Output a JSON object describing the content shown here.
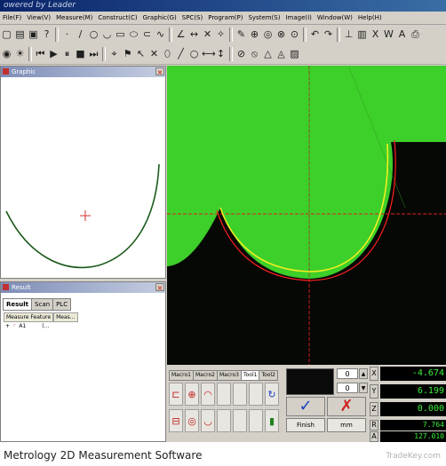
{
  "window": {
    "title": "owered by Leader"
  },
  "menubar": [
    "File(F)",
    "View(V)",
    "Measure(M)",
    "Construct(C)",
    "Graphic(G)",
    "SPC(S)",
    "Program(P)",
    "System(S)",
    "Image(I)",
    "Window(W)",
    "Help(H)"
  ],
  "graphic_panel": {
    "title": "Graphic",
    "close": "×"
  },
  "result_panel": {
    "title": "Result",
    "close": "×",
    "tabs": [
      "Result",
      "Scan",
      "PLC"
    ],
    "columns": [
      "Measure Feature",
      "Meas..."
    ],
    "rows": [
      {
        "icon": "arc-icon",
        "name": "A1",
        "value": "(..."
      }
    ]
  },
  "macro_tabs": [
    "Macro1",
    "Macro2",
    "Macro3",
    "Tool1",
    "Tool2"
  ],
  "controls": {
    "spin_top": "0",
    "spin_bottom": "0",
    "ok_symbol": "✓",
    "cancel_symbol": "✗",
    "finish_label": "Finish",
    "unit_label": "mm"
  },
  "axes": [
    {
      "label": "X",
      "value": "-4.674"
    },
    {
      "label": "Y",
      "value": "6.199"
    },
    {
      "label": "Z",
      "value": "0.000"
    },
    {
      "label": "R",
      "value": "7.764"
    },
    {
      "label": "A",
      "value": "127.010"
    }
  ],
  "caption": "Metrology 2D Measurement Software",
  "watermark": "TradeKey.com",
  "colors": {
    "part": "#3dcf2a",
    "crosshair": "#e02020",
    "fit_outer": "#ff2020",
    "fit_inner": "#f0f020",
    "arc_graphic": "#1a5a1a"
  }
}
